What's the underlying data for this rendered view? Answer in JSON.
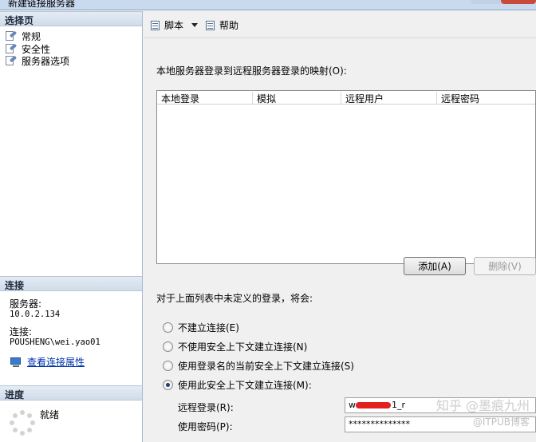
{
  "window": {
    "title": "新建链接服务器"
  },
  "left": {
    "select_page_header": "选择页",
    "pages": [
      {
        "label": "常规",
        "icon": "page-settings-icon"
      },
      {
        "label": "安全性",
        "icon": "page-settings-icon"
      },
      {
        "label": "服务器选项",
        "icon": "page-settings-icon"
      }
    ],
    "connection_header": "连接",
    "server_label": "服务器:",
    "server_value": "10.0.2.134",
    "connection_label": "连接:",
    "connection_value": "POUSHENG\\wei.yao01",
    "view_properties_link": "查看连接属性",
    "progress_header": "进度",
    "progress_status": "就绪"
  },
  "toolbar": {
    "script_label": "脚本",
    "help_label": "帮助"
  },
  "security": {
    "mapping_label": "本地服务器登录到远程服务器登录的映射(O):",
    "columns": [
      "本地登录",
      "模拟",
      "远程用户",
      "远程密码"
    ],
    "rows": [],
    "add_button": "添加(A)",
    "remove_button": "删除(V)",
    "undefined_label": "对于上面列表中未定义的登录，将会:",
    "options": [
      {
        "label": "不建立连接(E)",
        "checked": false
      },
      {
        "label": "不使用安全上下文建立连接(N)",
        "checked": false
      },
      {
        "label": "使用登录名的当前安全上下文建立连接(S)",
        "checked": false
      },
      {
        "label": "使用此安全上下文建立连接(M):",
        "checked": true
      }
    ],
    "remote_login_label": "远程登录(R):",
    "remote_login_prefix": "w",
    "remote_login_suffix": "1_r",
    "password_label": "使用密码(P):",
    "password_value": "**************"
  },
  "watermark": {
    "line1": "知乎 @墨痕九州",
    "line2": "@ITPUB博客"
  }
}
